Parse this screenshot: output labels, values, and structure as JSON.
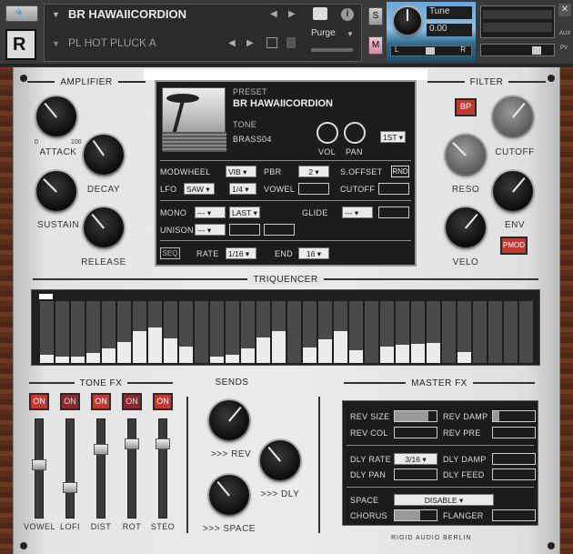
{
  "header": {
    "instrument_name": "BR HAWAIICORDION",
    "preset_name": "PL HOT PLUCK A",
    "purge_label": "Purge",
    "solo_label": "S",
    "mute_label": "M",
    "tune_label": "Tune",
    "tune_value": "0.00",
    "pan_left": "L",
    "pan_right": "R",
    "aux_label": "AUX",
    "pv_label": "PV"
  },
  "amplifier": {
    "title": "AMPLIFIER",
    "attack": "ATTACK",
    "decay": "DECAY",
    "sustain": "SUSTAIN",
    "release": "RELEASE",
    "scale_min": "0",
    "scale_max": "100"
  },
  "display": {
    "preset_label": "PRESET",
    "preset_name": "BR HAWAIICORDION",
    "tone_label": "TONE",
    "tone_value": "BRASS04",
    "vol_label": "VOL",
    "pan_label": "PAN",
    "oct_value": "1ST",
    "modwheel_label": "MODWHEEL",
    "modwheel_value": "VIB",
    "pbr_label": "PBR",
    "pbr_value": "2",
    "soffset_label": "S.OFFSET",
    "rnd_label": "RND",
    "lfo_label": "LFO",
    "lfo_wave": "SAW",
    "lfo_rate": "1/4",
    "vowel_label": "VOWEL",
    "cutoff_label": "CUTOFF",
    "mono_label": "MONO",
    "mono_value": "---",
    "last_value": "LAST",
    "glide_label": "GLIDE",
    "glide_value": "---",
    "unison_label": "UNISON",
    "unison_value": "---",
    "seq_label": "SEQ",
    "rate_label": "RATE",
    "rate_value": "1/16",
    "end_label": "END",
    "end_value": "16"
  },
  "filter": {
    "title": "FILTER",
    "bp_label": "BP",
    "cutoff": "CUTOFF",
    "reso": "RESO",
    "env": "ENV",
    "velo": "VELO",
    "pmod_label": "PMOD",
    "scale_min": "0",
    "scale_max": "100"
  },
  "triquencer": {
    "title": "TRIQUENCER",
    "steps": [
      0.13,
      0.1,
      0.11,
      0.16,
      0.24,
      0.34,
      0.52,
      0.58,
      0.4,
      0.26,
      0,
      0.1,
      0.13,
      0.24,
      0.41,
      0.51,
      0,
      0.25,
      0.38,
      0.52,
      0.2,
      0,
      0.27,
      0.3,
      0.31,
      0.33,
      0,
      0.18,
      0,
      0,
      0,
      0
    ]
  },
  "tonefx": {
    "title": "TONE FX",
    "on_label": "ON",
    "channels": [
      {
        "name": "VOWEL",
        "on": true,
        "level": 0.55
      },
      {
        "name": "LOFI",
        "on": false,
        "level": 0.3
      },
      {
        "name": "DIST",
        "on": true,
        "level": 0.72
      },
      {
        "name": "ROT",
        "on": false,
        "level": 0.78
      },
      {
        "name": "STEO",
        "on": true,
        "level": 0.78
      }
    ]
  },
  "sends": {
    "title": "SENDS",
    "rev": ">>> REV",
    "dly": ">>> DLY",
    "space": ">>> SPACE",
    "scale_min": "0",
    "scale_max": "100"
  },
  "masterfx": {
    "title": "MASTER FX",
    "rev_size": "REV SIZE",
    "rev_damp": "REV DAMP",
    "rev_col": "REV COL",
    "rev_pre": "REV PRE",
    "dly_rate": "DLY RATE",
    "dly_rate_value": "3/16",
    "dly_damp": "DLY DAMP",
    "dly_pan": "DLY PAN",
    "dly_feed": "DLY FEED",
    "space": "SPACE",
    "space_value": "DISABLE",
    "chorus": "CHORUS",
    "flanger": "FLANGER"
  },
  "footer": {
    "brand": "RIGID AUDIO BERLIN"
  }
}
